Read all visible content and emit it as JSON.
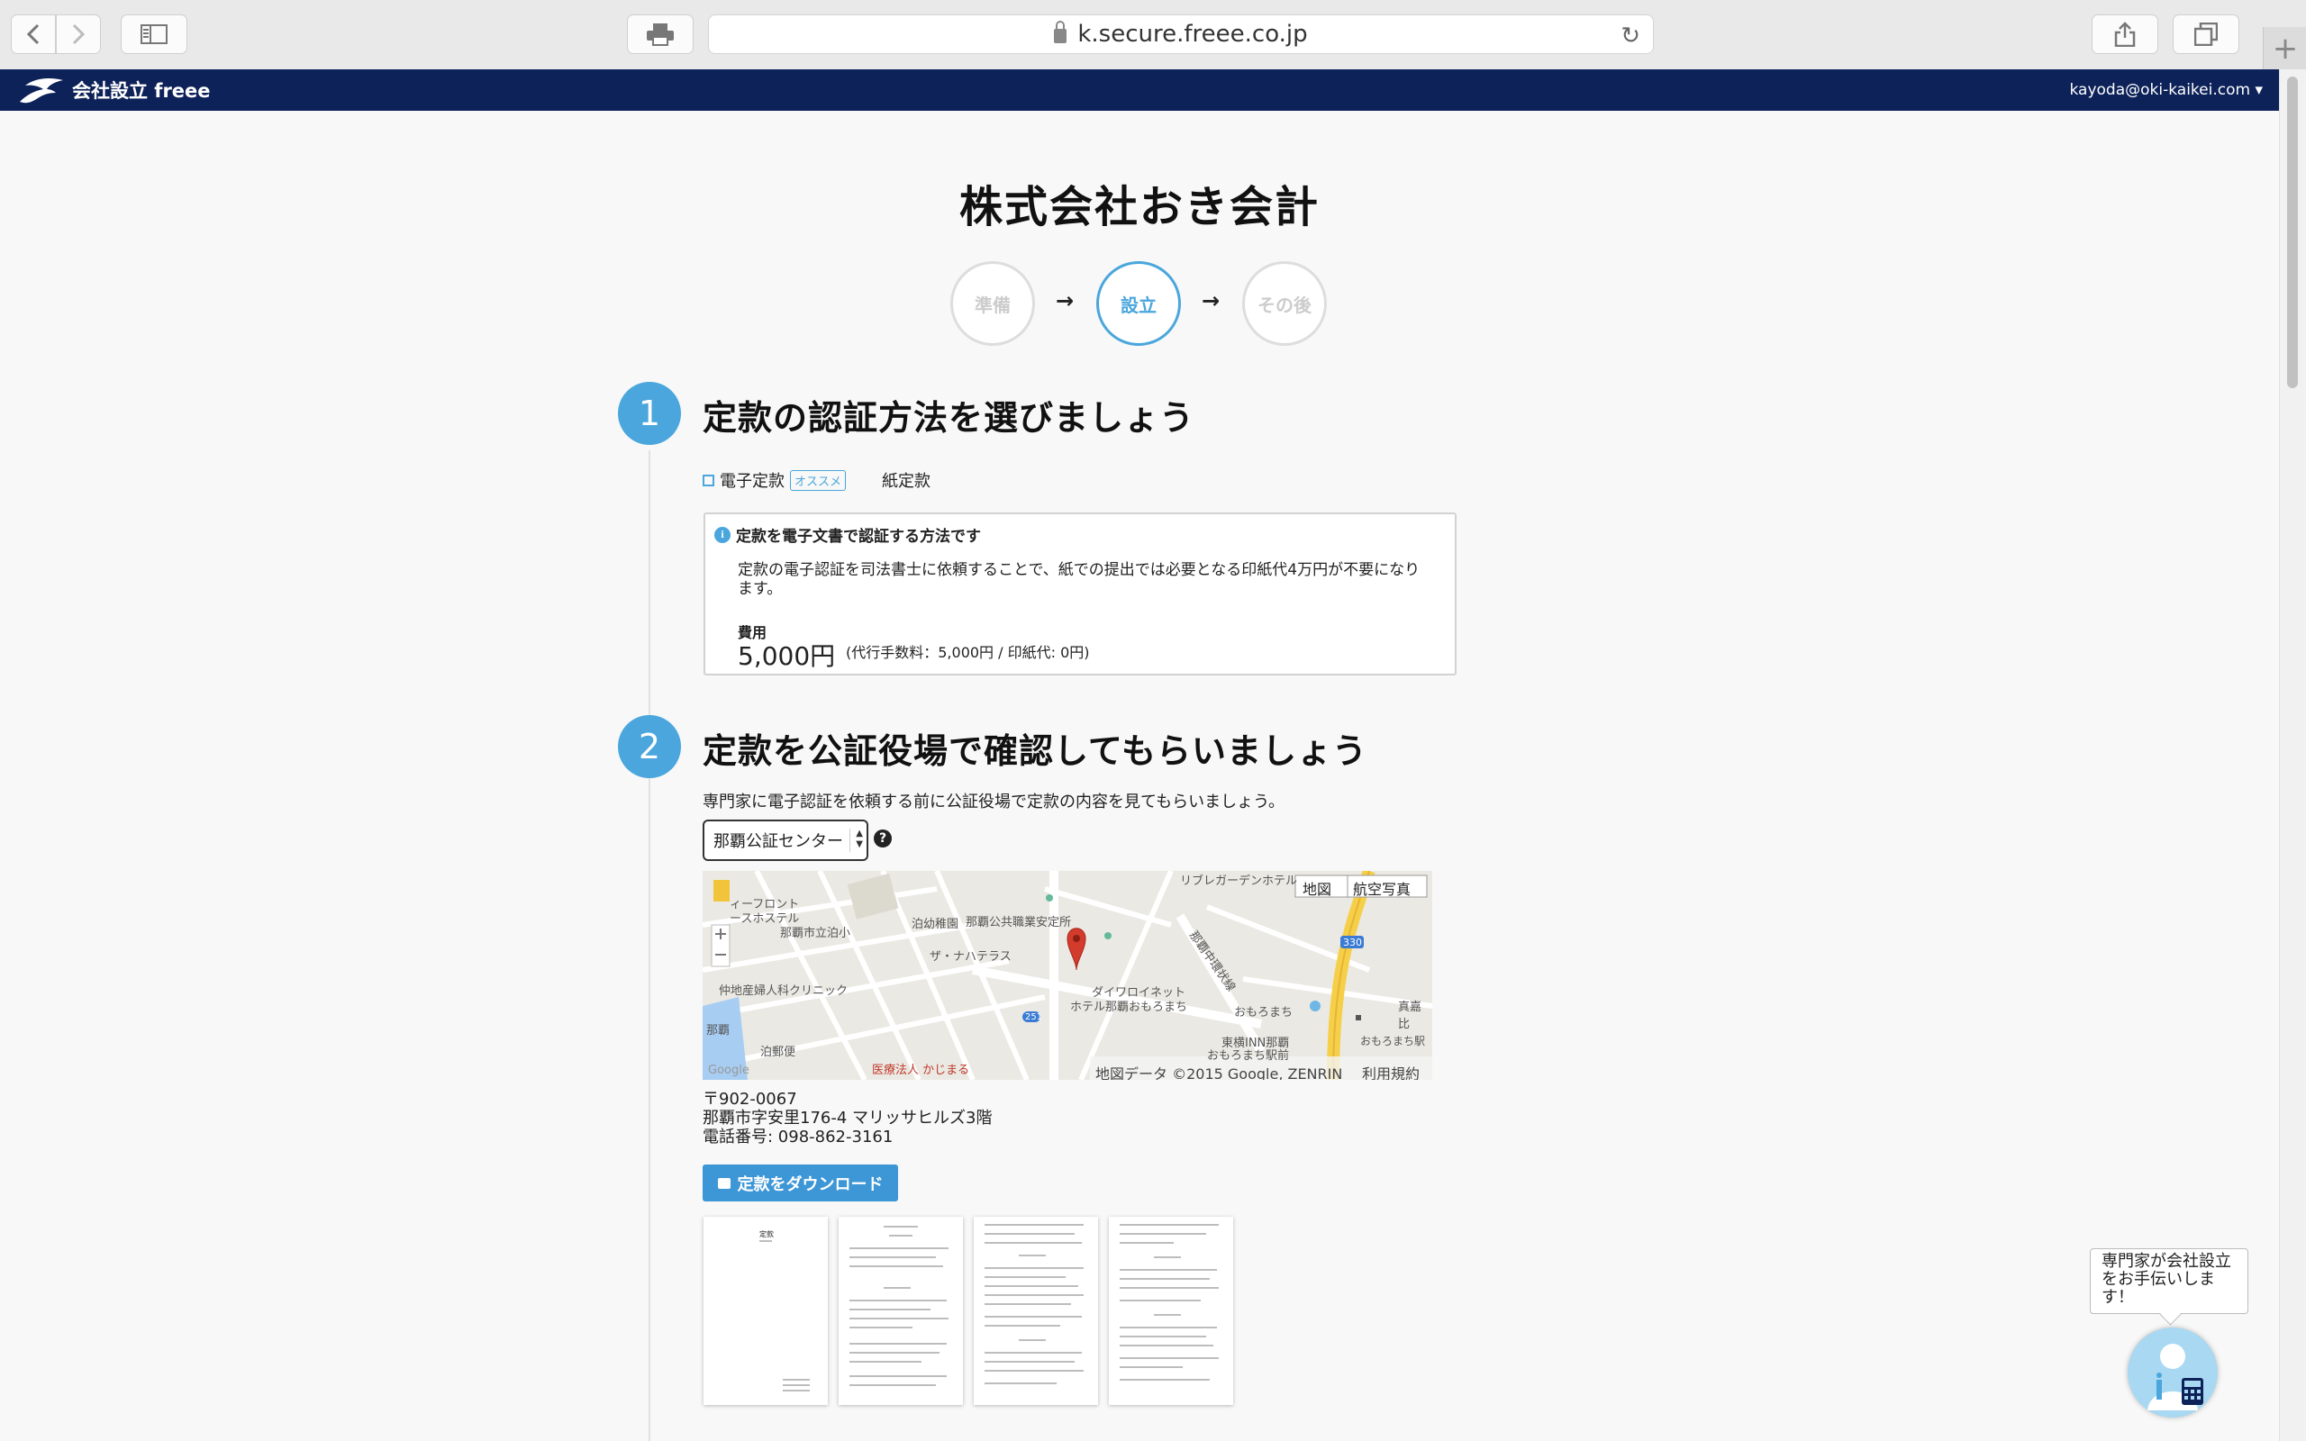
{
  "browser": {
    "url": "k.secure.freee.co.jp"
  },
  "app": {
    "brand": "会社設立 freee",
    "user": "kayoda@oki-kaikei.com ▾"
  },
  "company_title": "株式会社おき会計",
  "steps": [
    {
      "label": "準備",
      "active": false
    },
    {
      "label": "設立",
      "active": true
    },
    {
      "label": "その後",
      "active": false
    }
  ],
  "section1": {
    "number": "1",
    "title": "定款の認証方法を選びましょう",
    "option_electronic": "電子定款",
    "option_badge": "オススメ",
    "option_paper": "紙定款",
    "info_title": "定款を電子文書で認証する方法です",
    "info_body": "定款の電子認証を司法書士に依頼することで、紙での提出では必要となる印紙代4万円が不要になります。",
    "fee_label": "費用",
    "fee_amount": "5,000円",
    "fee_note": "(代行手数料：5,000円 / 印紙代: 0円)"
  },
  "section2": {
    "number": "2",
    "title": "定款を公証役場で確認してもらいましょう",
    "description": "専門家に電子認証を依頼する前に公証役場で定款の内容を見てもらいましょう。",
    "office_select": "那覇公証センター",
    "help": "?",
    "map": {
      "tab_map": "地図",
      "tab_aerial": "航空写真",
      "labels": [
        "リブレガーデンホテル",
        "ィーフロント",
        "ースホステル",
        "那覇市立泊小",
        "泊幼稚園",
        "那覇公共職業安定所",
        "ザ・ナハテラス",
        "仲地産婦人科クリニック",
        "ダイワロイネット",
        "ホテル那覇おもろまち",
        "那覇中環状線",
        "おもろまち",
        "東横INN那覇",
        "おもろまち駅前",
        "医療法人 かじまる",
        "泊郵便",
        "那覇",
        "真嘉比",
        "おもろまち駅"
      ],
      "road_numbers": [
        "330",
        "251"
      ],
      "attribution": "地図データ ©2015 Google, ZENRIN",
      "terms": "利用規約",
      "logo": "Google"
    },
    "address_postal": "〒902-0067",
    "address_line": "那覇市字安里176-4 マリッサヒルズ3階",
    "phone": "電話番号: 098-862-3161",
    "download_label": "定款をダウンロード",
    "doc_thumbnail_title": "定款"
  },
  "assistant": {
    "text": "専門家が会社設立をお手伝いします！"
  }
}
